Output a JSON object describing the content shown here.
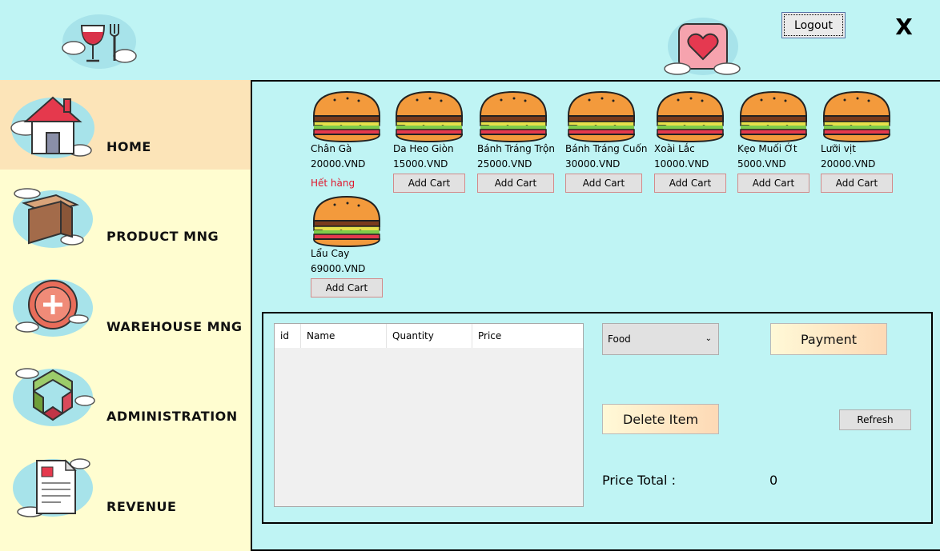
{
  "header": {
    "logout_label": "Logout",
    "close_label": "X"
  },
  "sidebar": {
    "items": [
      {
        "label": "HOME",
        "icon": "home-icon",
        "active": true
      },
      {
        "label": "PRODUCT MNG",
        "icon": "box-icon",
        "active": false
      },
      {
        "label": "WAREHOUSE MNG",
        "icon": "plus-circle-icon",
        "active": false
      },
      {
        "label": "ADMINISTRATION",
        "icon": "hexagon-logo-icon",
        "active": false
      },
      {
        "label": "REVENUE",
        "icon": "document-icon",
        "active": false
      }
    ]
  },
  "products": [
    {
      "name": "Chân Gà",
      "price": "20000.VND",
      "status": "Hết hàng"
    },
    {
      "name": "Da Heo Giòn",
      "price": "15000.VND",
      "action": "Add Cart"
    },
    {
      "name": "Bánh Tráng Trộn",
      "price": "25000.VND",
      "action": "Add Cart"
    },
    {
      "name": "Bánh Tráng Cuốn",
      "price": "30000.VND",
      "action": "Add Cart"
    },
    {
      "name": "Xoài Lắc",
      "price": "10000.VND",
      "action": "Add Cart"
    },
    {
      "name": "Kẹo Muối Ớt",
      "price": "5000.VND",
      "action": "Add Cart"
    },
    {
      "name": "Lưỡi vịt",
      "price": "20000.VND",
      "action": "Add Cart"
    },
    {
      "name": "Lẩu Cay",
      "price": "69000.VND",
      "action": "Add Cart"
    }
  ],
  "cart": {
    "columns": [
      "id",
      "Name",
      "Quantity",
      "Price"
    ],
    "rows": []
  },
  "controls": {
    "category_selected": "Food",
    "payment_label": "Payment",
    "delete_label": "Delete Item",
    "refresh_label": "Refresh",
    "total_label": "Price Total :",
    "total_value": "0"
  },
  "colors": {
    "background": "#bff4f4",
    "sidebar": "#fffdd0",
    "sidebar_active": "#fce4b8",
    "out_of_stock": "#e0162b"
  }
}
